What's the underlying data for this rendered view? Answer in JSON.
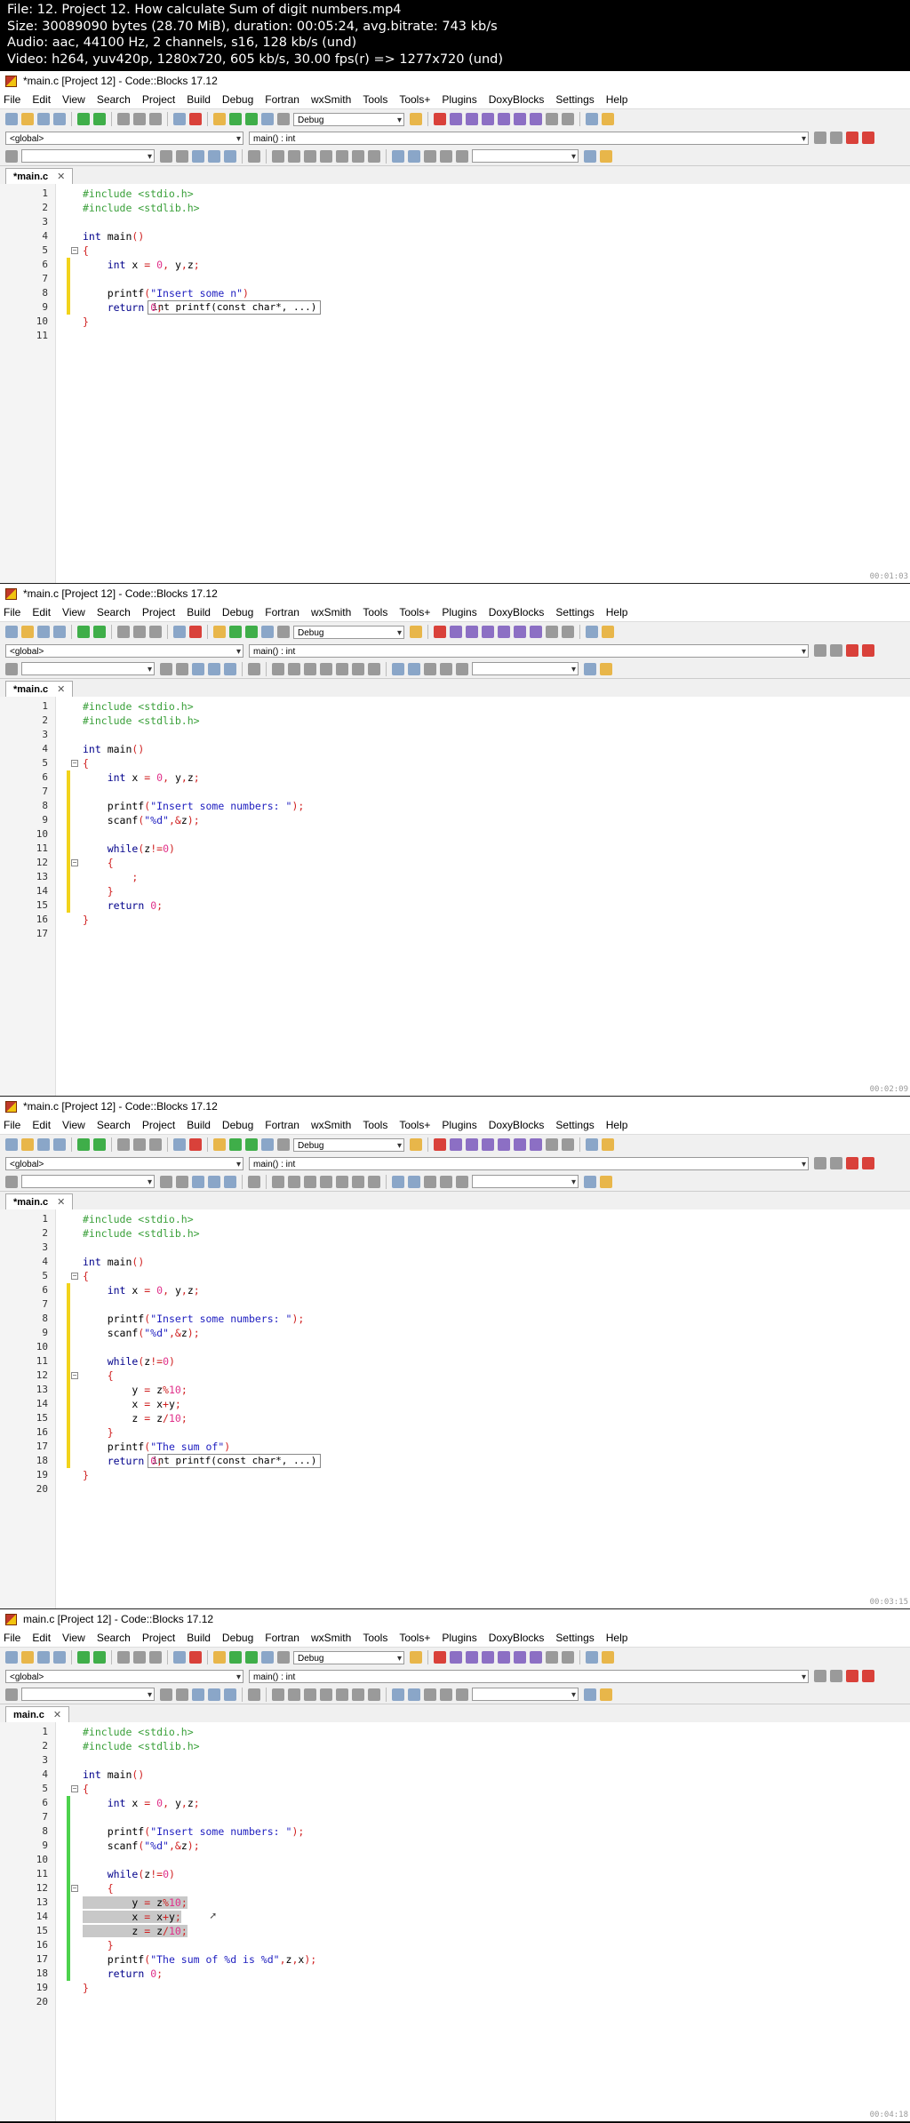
{
  "info": [
    "File: 12. Project 12. How calculate Sum of digit numbers.mp4",
    "Size: 30089090 bytes (28.70 MiB), duration: 00:05:24, avg.bitrate: 743 kb/s",
    "Audio: aac, 44100 Hz, 2 channels, s16, 128 kb/s (und)",
    "Video: h264, yuv420p, 1280x720, 605 kb/s, 30.00 fps(r) => 1277x720 (und)"
  ],
  "menu": [
    "File",
    "Edit",
    "View",
    "Search",
    "Project",
    "Build",
    "Debug",
    "Fortran",
    "wxSmith",
    "Tools",
    "Tools+",
    "Plugins",
    "DoxyBlocks",
    "Settings",
    "Help"
  ],
  "build_target": "Debug",
  "scope": "<global>",
  "function": "main() : int",
  "tooltip": "int printf(const char*, ...)",
  "frames": [
    {
      "title": "*main.c [Project 12] - Code::Blocks 17.12",
      "tab": "*main.c",
      "timestamp": "00:01:03",
      "lines": [
        "#include <stdio.h>",
        "#include <stdlib.h>",
        "",
        "int main()",
        "{",
        "    int x = 0, y,z;",
        "",
        "    printf(\"Insert some n\")",
        "    return 0;",
        "}",
        ""
      ]
    },
    {
      "title": "*main.c [Project 12] - Code::Blocks 17.12",
      "tab": "*main.c",
      "timestamp": "00:02:09",
      "lines": [
        "#include <stdio.h>",
        "#include <stdlib.h>",
        "",
        "int main()",
        "{",
        "    int x = 0, y,z;",
        "",
        "    printf(\"Insert some numbers: \");",
        "    scanf(\"%d\",&z);",
        "",
        "    while(z!=0)",
        "    {",
        "        ;",
        "    }",
        "    return 0;",
        "}",
        ""
      ]
    },
    {
      "title": "*main.c [Project 12] - Code::Blocks 17.12",
      "tab": "*main.c",
      "timestamp": "00:03:15",
      "lines": [
        "#include <stdio.h>",
        "#include <stdlib.h>",
        "",
        "int main()",
        "{",
        "    int x = 0, y,z;",
        "",
        "    printf(\"Insert some numbers: \");",
        "    scanf(\"%d\",&z);",
        "",
        "    while(z!=0)",
        "    {",
        "        y = z%10;",
        "        x = x+y;",
        "        z = z/10;",
        "    }",
        "    printf(\"The sum of\")",
        "    return 0;",
        "}",
        ""
      ]
    },
    {
      "title": "main.c [Project 12] - Code::Blocks 17.12",
      "tab": "main.c",
      "timestamp": "00:04:18",
      "lines": [
        "#include <stdio.h>",
        "#include <stdlib.h>",
        "",
        "int main()",
        "{",
        "    int x = 0, y,z;",
        "",
        "    printf(\"Insert some numbers: \");",
        "    scanf(\"%d\",&z);",
        "",
        "    while(z!=0)",
        "    {",
        "        y = z%10;",
        "        x = x+y;",
        "        z = z/10;",
        "    }",
        "    printf(\"The sum of %d is %d\",z,x);",
        "    return 0;",
        "}",
        ""
      ]
    }
  ]
}
